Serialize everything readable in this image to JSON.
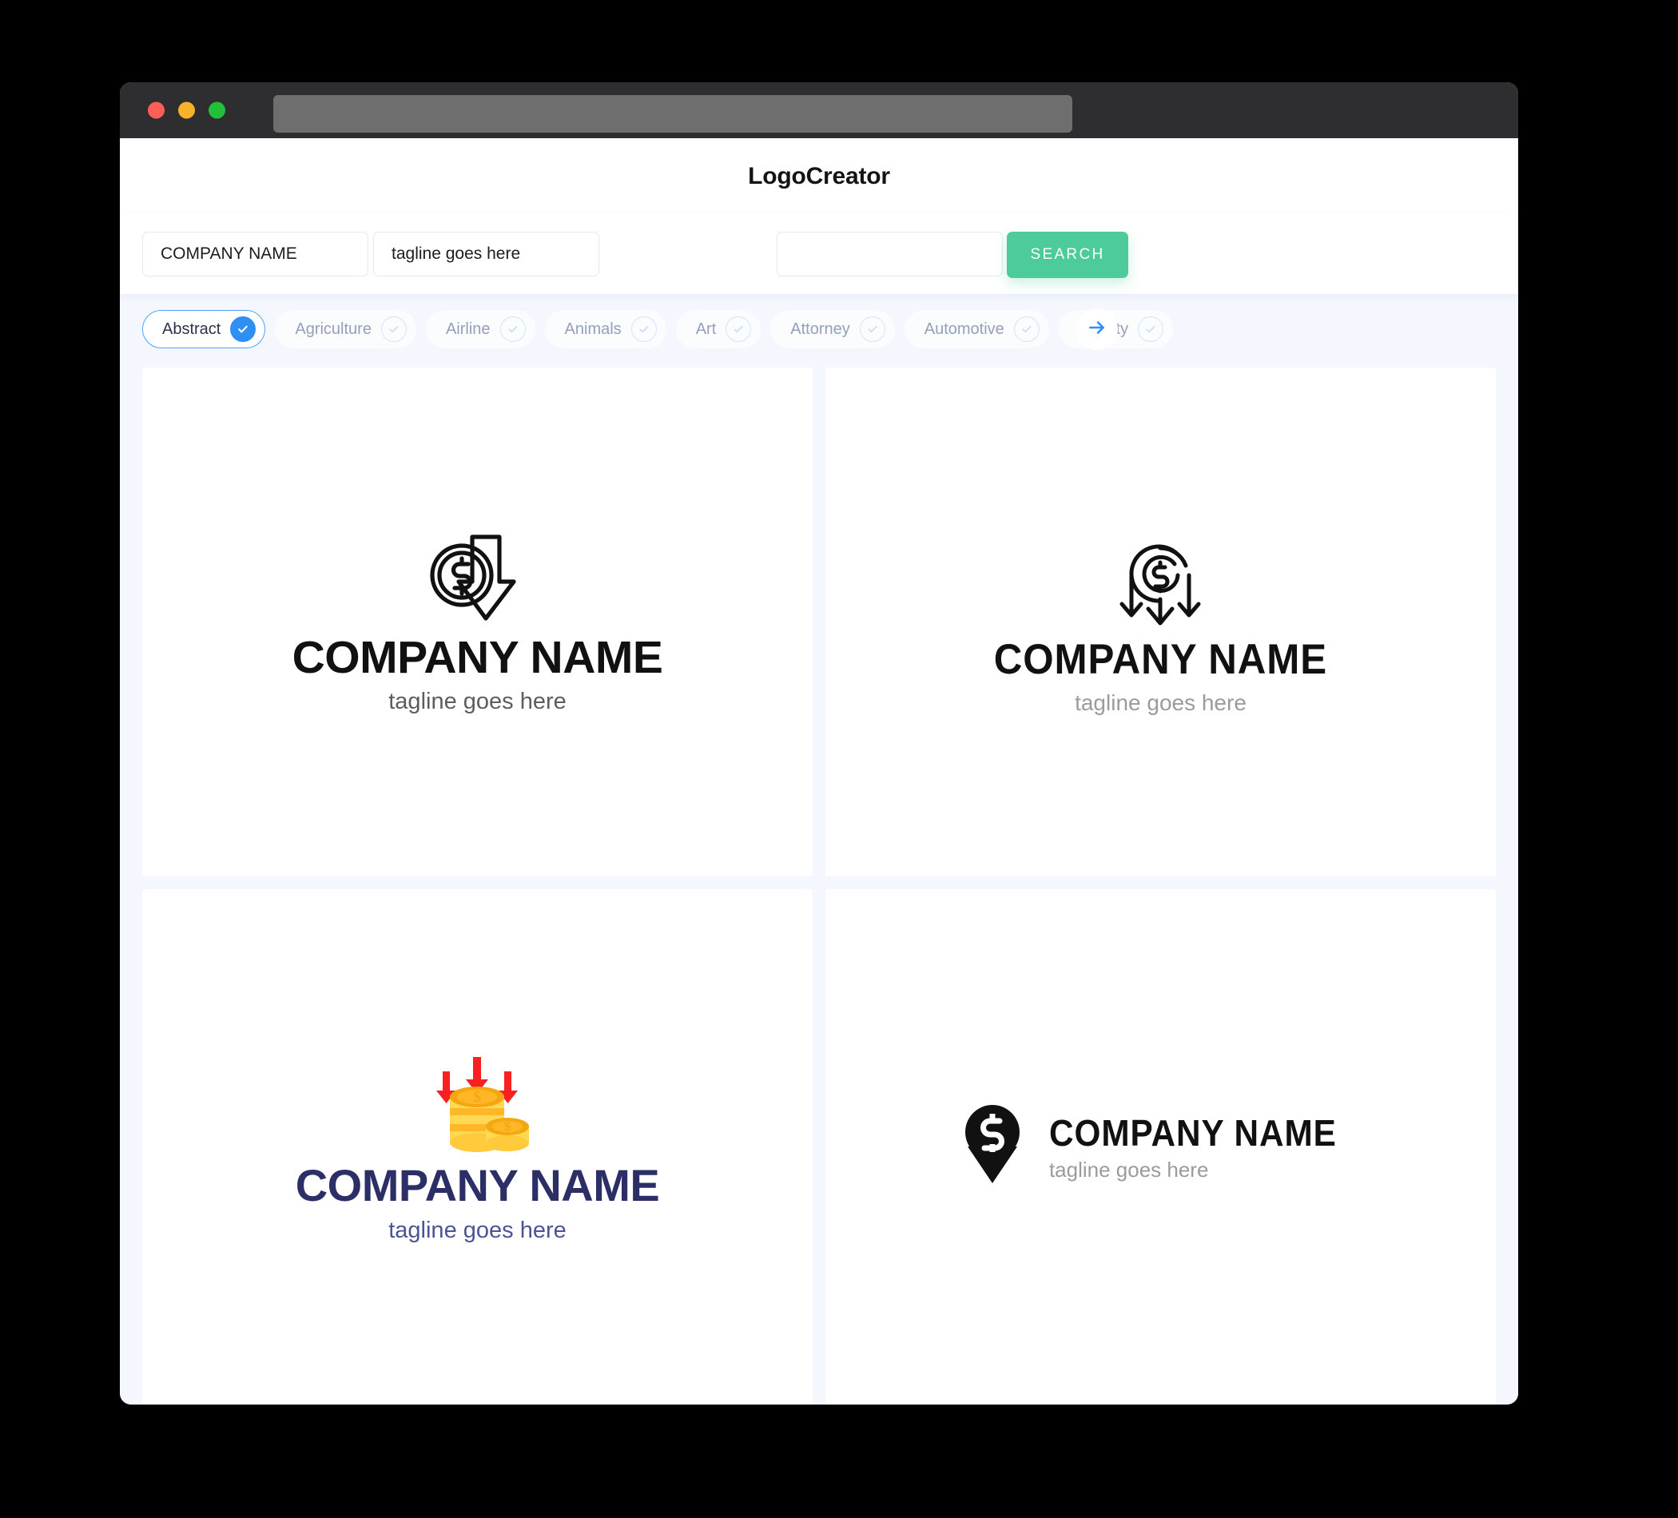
{
  "window": {
    "traffic_lights": [
      "close",
      "minimize",
      "maximize"
    ],
    "url_value": ""
  },
  "header": {
    "app_title": "LogoCreator"
  },
  "search": {
    "company_value": "COMPANY NAME",
    "company_placeholder": "COMPANY NAME",
    "tagline_value": "tagline goes here",
    "tagline_placeholder": "tagline goes here",
    "extra_value": "",
    "extra_placeholder": "",
    "search_label": "SEARCH"
  },
  "categories": {
    "next_icon": "arrow-right-icon",
    "items": [
      {
        "label": "Abstract",
        "selected": true
      },
      {
        "label": "Agriculture",
        "selected": false
      },
      {
        "label": "Airline",
        "selected": false
      },
      {
        "label": "Animals",
        "selected": false
      },
      {
        "label": "Art",
        "selected": false
      },
      {
        "label": "Attorney",
        "selected": false
      },
      {
        "label": "Automotive",
        "selected": false
      },
      {
        "label": "Beauty",
        "selected": false
      }
    ]
  },
  "results": [
    {
      "icon": "dollar-coin-down-arrow-outline-icon",
      "name": "COMPANY NAME",
      "tagline": "tagline goes here",
      "name_color": "#111111",
      "tagline_color": "#5d5d5d"
    },
    {
      "icon": "dollar-coin-three-arrows-down-outline-icon",
      "name": "COMPANY NAME",
      "tagline": "tagline goes here",
      "name_color": "#111111",
      "tagline_color": "#9b9b9b"
    },
    {
      "icon": "gold-coin-stack-red-arrows-icon",
      "name": "COMPANY NAME",
      "tagline": "tagline goes here",
      "name_color": "#2b2f66",
      "tagline_color": "#4b5494"
    },
    {
      "icon": "dollar-coin-solid-down-arrow-icon",
      "name": "COMPANY NAME",
      "tagline": "tagline goes here",
      "name_color": "#111111",
      "tagline_color": "#9b9b9b"
    }
  ],
  "colors": {
    "accent_green": "#4ecb9b",
    "accent_blue": "#2f8ff5",
    "page_background": "#f4f7fd",
    "titlebar": "#2e2e30",
    "coin_gold": "#f5a711",
    "arrow_red": "#f82020",
    "navy": "#2b2f66"
  }
}
